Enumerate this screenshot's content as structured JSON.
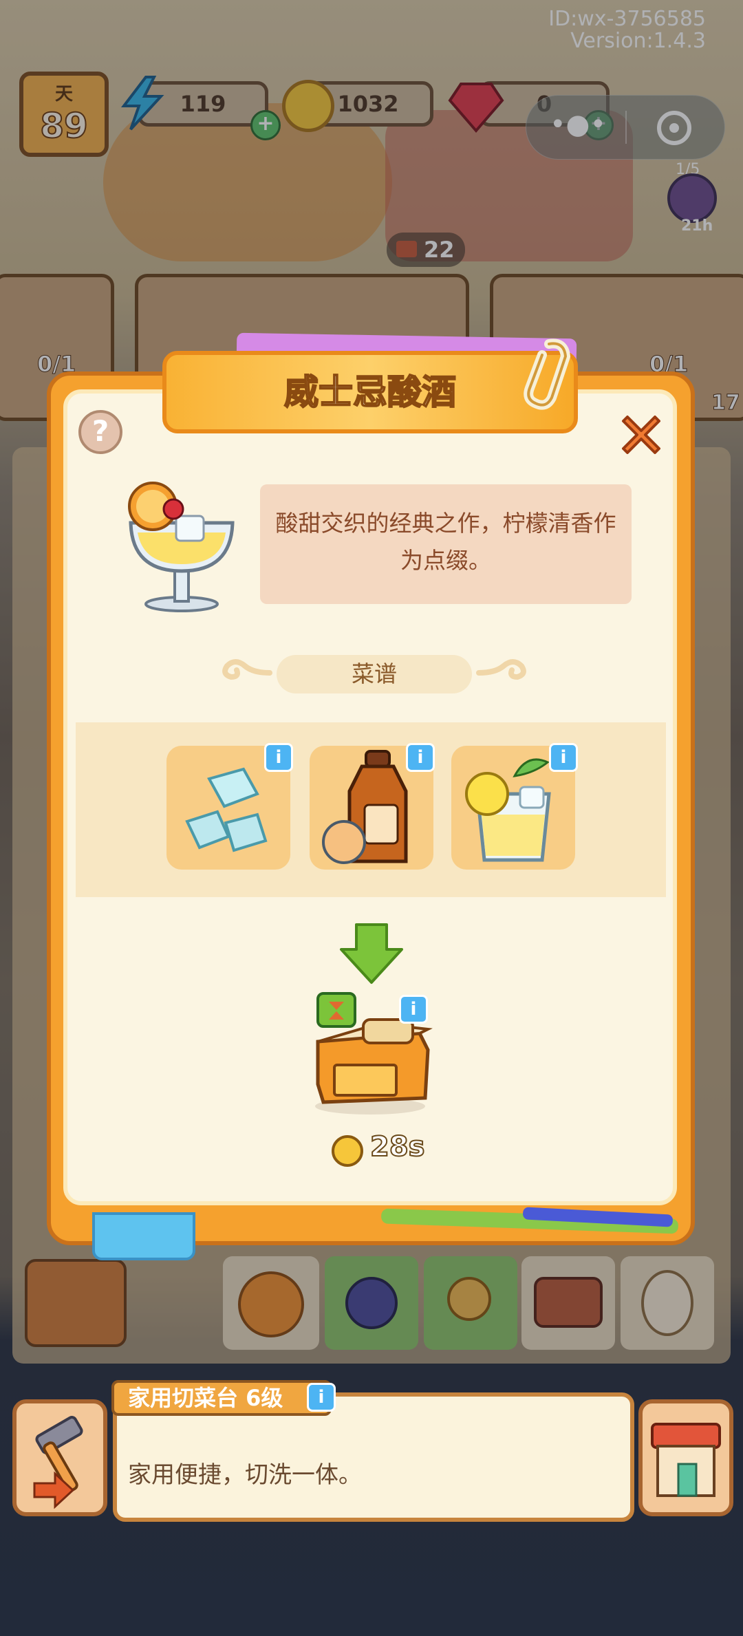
{
  "hud": {
    "day_label": "天",
    "day_value": "89",
    "energy": "119",
    "coins": "1032",
    "gems": "0"
  },
  "top_right": {
    "id_text": "ID:wx-3756585",
    "version_text": "Version:1.4.3"
  },
  "side_counter": {
    "fraction": "1/5",
    "timer": "21h"
  },
  "stack_counter": "22",
  "orders": {
    "left_progress": "0/1",
    "right_progress": "0/1",
    "right_count": "17"
  },
  "modal": {
    "title": "威士忌酸酒",
    "help_label": "?",
    "description": "酸甜交织的经典之作，柠檬清香作为点缀。",
    "recipe_label": "菜谱",
    "ingredients": [
      {
        "icon": "ice-cubes-icon"
      },
      {
        "icon": "whiskey-bottle-icon"
      },
      {
        "icon": "lemon-drink-icon"
      }
    ],
    "info_label": "i",
    "station_icon": "cutting-board-station-icon",
    "time": "28s"
  },
  "bottom": {
    "tool_name": "家用切菜台 6级",
    "tool_desc": "家用便捷，切洗一体。"
  },
  "colors": {
    "modal_orange": "#f5a12e",
    "title_text": "#ffffff",
    "info_blue": "#4db4f3",
    "desc_bg": "#f4d8c1"
  }
}
